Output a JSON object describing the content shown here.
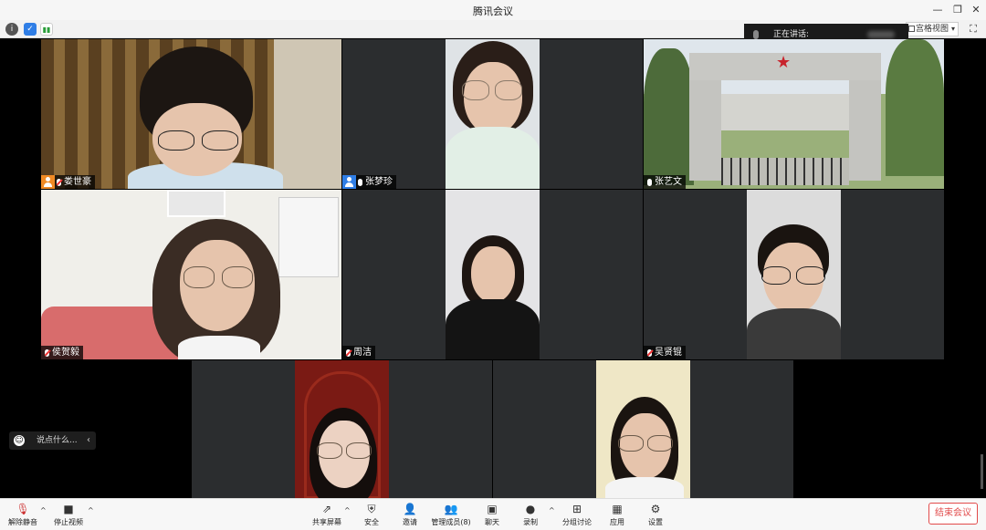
{
  "window": {
    "title": "腾讯会议"
  },
  "statusbar": {
    "view_button": "宫格视图",
    "speaking_label": "正在讲话:"
  },
  "participants": [
    {
      "name": "娄世豪",
      "host": true,
      "muted": true
    },
    {
      "name": "张梦珍",
      "host": true,
      "muted": false
    },
    {
      "name": "张艺文",
      "host": false,
      "muted": false
    },
    {
      "name": "侯贺毅",
      "host": false,
      "muted": true
    },
    {
      "name": "周洁",
      "host": false,
      "muted": true
    },
    {
      "name": "吴贤锟",
      "host": false,
      "muted": true
    },
    {
      "name": "",
      "host": false,
      "muted": false
    },
    {
      "name": "",
      "host": false,
      "muted": false
    }
  ],
  "chat": {
    "placeholder": "说点什么..."
  },
  "toolbar": {
    "unmute": "解除静音",
    "stop_video": "停止视频",
    "share_screen": "共享屏幕",
    "security": "安全",
    "invite": "邀请",
    "manage_members": "管理成员(8)",
    "chat": "聊天",
    "record": "录制",
    "breakout": "分组讨论",
    "apps": "应用",
    "settings": "设置",
    "end_meeting": "结束会议"
  },
  "colors": {
    "accent_red": "#e24b4b",
    "tile_bg": "#2b2d2f",
    "host_badge_orange": "#f08a24",
    "host_badge_blue": "#2f7ee6"
  }
}
